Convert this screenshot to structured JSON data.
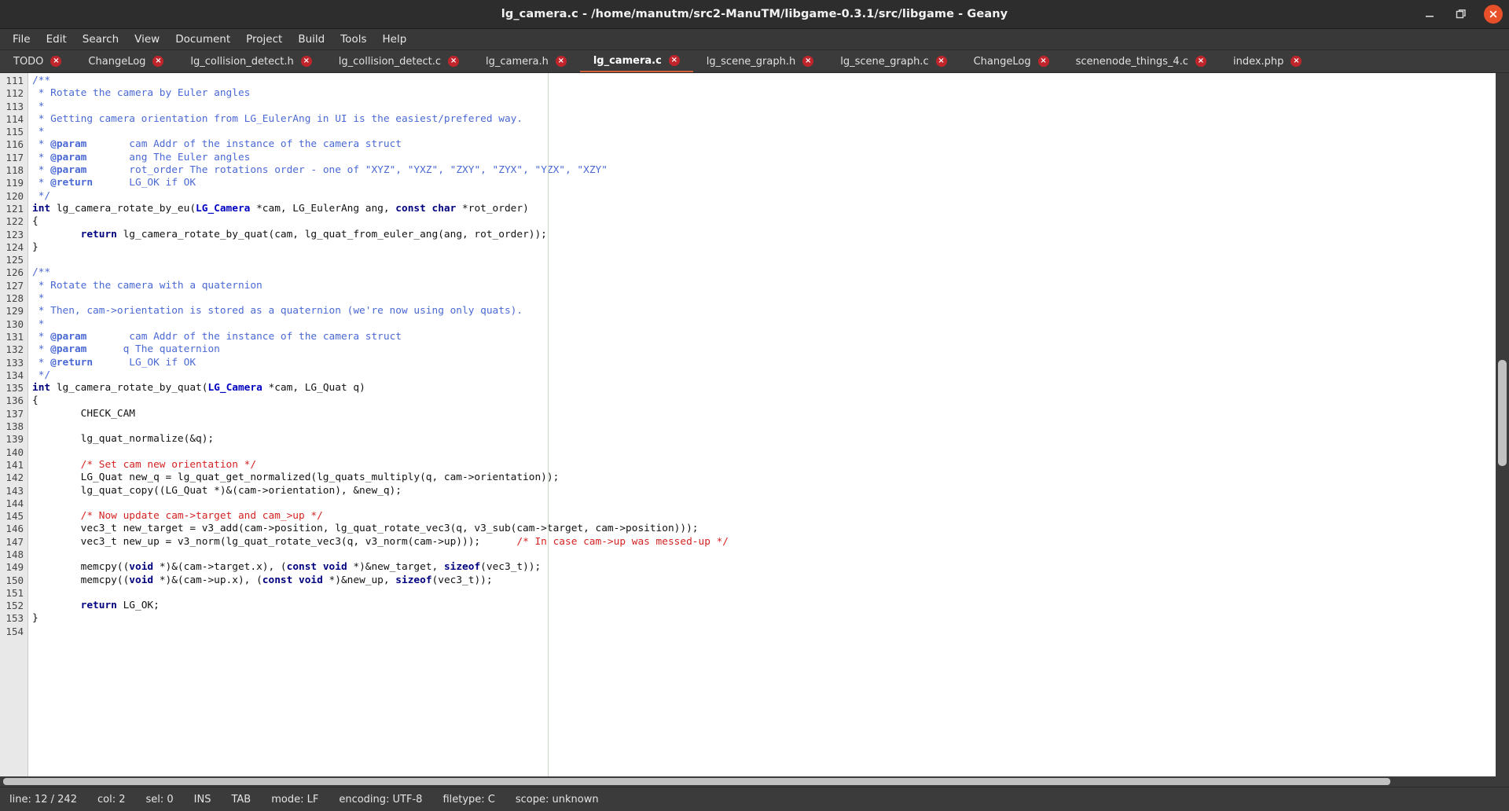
{
  "window": {
    "title": "lg_camera.c - /home/manutm/src2-ManuTM/libgame-0.3.1/src/libgame - Geany",
    "controls": {
      "minimize": "minimize-icon",
      "maximize": "maximize-icon",
      "close": "close-icon"
    }
  },
  "menubar": {
    "items": [
      {
        "label": "File"
      },
      {
        "label": "Edit"
      },
      {
        "label": "Search"
      },
      {
        "label": "View"
      },
      {
        "label": "Document"
      },
      {
        "label": "Project"
      },
      {
        "label": "Build"
      },
      {
        "label": "Tools"
      },
      {
        "label": "Help"
      }
    ]
  },
  "tabs": {
    "close_glyph": "×",
    "items": [
      {
        "label": "TODO",
        "active": false
      },
      {
        "label": "ChangeLog",
        "active": false
      },
      {
        "label": "lg_collision_detect.h",
        "active": false
      },
      {
        "label": "lg_collision_detect.c",
        "active": false
      },
      {
        "label": "lg_camera.h",
        "active": false
      },
      {
        "label": "lg_camera.c",
        "active": true
      },
      {
        "label": "lg_scene_graph.h",
        "active": false
      },
      {
        "label": "lg_scene_graph.c",
        "active": false
      },
      {
        "label": "ChangeLog",
        "active": false
      },
      {
        "label": "scenenode_things_4.c",
        "active": false
      },
      {
        "label": "index.php",
        "active": false
      }
    ]
  },
  "editor": {
    "first_line": 111,
    "lines": [
      {
        "n": 111,
        "tokens": [
          {
            "t": "/**",
            "c": "t-com"
          }
        ]
      },
      {
        "n": 112,
        "tokens": [
          {
            "t": " * Rotate the camera by Euler angles",
            "c": "t-com"
          }
        ]
      },
      {
        "n": 113,
        "tokens": [
          {
            "t": " *",
            "c": "t-com"
          }
        ]
      },
      {
        "n": 114,
        "tokens": [
          {
            "t": " * Getting camera orientation from LG_EulerAng in UI is the easiest/prefered way.",
            "c": "t-com"
          }
        ]
      },
      {
        "n": 115,
        "tokens": [
          {
            "t": " *",
            "c": "t-com"
          }
        ]
      },
      {
        "n": 116,
        "tokens": [
          {
            "t": " * ",
            "c": "t-com"
          },
          {
            "t": "@param",
            "c": "t-doc"
          },
          {
            "t": "       cam Addr of the instance of the camera struct",
            "c": "t-com"
          }
        ]
      },
      {
        "n": 117,
        "tokens": [
          {
            "t": " * ",
            "c": "t-com"
          },
          {
            "t": "@param",
            "c": "t-doc"
          },
          {
            "t": "       ang The Euler angles",
            "c": "t-com"
          }
        ]
      },
      {
        "n": 118,
        "tokens": [
          {
            "t": " * ",
            "c": "t-com"
          },
          {
            "t": "@param",
            "c": "t-doc"
          },
          {
            "t": "       rot_order The rotations order - one of \"XYZ\", \"YXZ\", \"ZXY\", \"ZYX\", \"YZX\", \"XZY\"",
            "c": "t-com"
          }
        ]
      },
      {
        "n": 119,
        "tokens": [
          {
            "t": " * ",
            "c": "t-com"
          },
          {
            "t": "@return",
            "c": "t-doc"
          },
          {
            "t": "      LG_OK if OK",
            "c": "t-com"
          }
        ]
      },
      {
        "n": 120,
        "tokens": [
          {
            "t": " */",
            "c": "t-com"
          }
        ]
      },
      {
        "n": 121,
        "tokens": [
          {
            "t": "int",
            "c": "t-kw"
          },
          {
            "t": " lg_camera_rotate_by_eu(",
            "c": "t-pl"
          },
          {
            "t": "LG_Camera",
            "c": "t-type"
          },
          {
            "t": " *cam, LG_EulerAng ang, ",
            "c": "t-pl"
          },
          {
            "t": "const char",
            "c": "t-kw"
          },
          {
            "t": " *rot_order)",
            "c": "t-pl"
          }
        ]
      },
      {
        "n": 122,
        "tokens": [
          {
            "t": "{",
            "c": "t-pl"
          }
        ]
      },
      {
        "n": 123,
        "tokens": [
          {
            "t": "        ",
            "c": "t-pl"
          },
          {
            "t": "return",
            "c": "t-kw"
          },
          {
            "t": " lg_camera_rotate_by_quat(cam, lg_quat_from_euler_ang(ang, rot_order));",
            "c": "t-pl"
          }
        ]
      },
      {
        "n": 124,
        "tokens": [
          {
            "t": "}",
            "c": "t-pl"
          }
        ]
      },
      {
        "n": 125,
        "tokens": [
          {
            "t": "",
            "c": "t-pl"
          }
        ]
      },
      {
        "n": 126,
        "tokens": [
          {
            "t": "/**",
            "c": "t-com"
          }
        ]
      },
      {
        "n": 127,
        "tokens": [
          {
            "t": " * Rotate the camera with a quaternion",
            "c": "t-com"
          }
        ]
      },
      {
        "n": 128,
        "tokens": [
          {
            "t": " *",
            "c": "t-com"
          }
        ]
      },
      {
        "n": 129,
        "tokens": [
          {
            "t": " * Then, cam->orientation is stored as a quaternion (we're now using only quats).",
            "c": "t-com"
          }
        ]
      },
      {
        "n": 130,
        "tokens": [
          {
            "t": " *",
            "c": "t-com"
          }
        ]
      },
      {
        "n": 131,
        "tokens": [
          {
            "t": " * ",
            "c": "t-com"
          },
          {
            "t": "@param",
            "c": "t-doc"
          },
          {
            "t": "       cam Addr of the instance of the camera struct",
            "c": "t-com"
          }
        ]
      },
      {
        "n": 132,
        "tokens": [
          {
            "t": " * ",
            "c": "t-com"
          },
          {
            "t": "@param",
            "c": "t-doc"
          },
          {
            "t": "      q The quaternion",
            "c": "t-com"
          }
        ]
      },
      {
        "n": 133,
        "tokens": [
          {
            "t": " * ",
            "c": "t-com"
          },
          {
            "t": "@return",
            "c": "t-doc"
          },
          {
            "t": "      LG_OK if OK",
            "c": "t-com"
          }
        ]
      },
      {
        "n": 134,
        "tokens": [
          {
            "t": " */",
            "c": "t-com"
          }
        ]
      },
      {
        "n": 135,
        "tokens": [
          {
            "t": "int",
            "c": "t-kw"
          },
          {
            "t": " lg_camera_rotate_by_quat(",
            "c": "t-pl"
          },
          {
            "t": "LG_Camera",
            "c": "t-type"
          },
          {
            "t": " *cam, LG_Quat q)",
            "c": "t-pl"
          }
        ]
      },
      {
        "n": 136,
        "tokens": [
          {
            "t": "{",
            "c": "t-pl"
          }
        ]
      },
      {
        "n": 137,
        "tokens": [
          {
            "t": "        CHECK_CAM",
            "c": "t-pl"
          }
        ]
      },
      {
        "n": 138,
        "tokens": [
          {
            "t": "",
            "c": "t-pl"
          }
        ]
      },
      {
        "n": 139,
        "tokens": [
          {
            "t": "        lg_quat_normalize(&q);",
            "c": "t-pl"
          }
        ]
      },
      {
        "n": 140,
        "tokens": [
          {
            "t": "",
            "c": "t-pl"
          }
        ]
      },
      {
        "n": 141,
        "tokens": [
          {
            "t": "        ",
            "c": "t-pl"
          },
          {
            "t": "/* Set cam new orientation */",
            "c": "t-comr"
          }
        ]
      },
      {
        "n": 142,
        "tokens": [
          {
            "t": "        LG_Quat new_q = lg_quat_get_normalized(lg_quats_multiply(q, cam->orientation));",
            "c": "t-pl"
          }
        ]
      },
      {
        "n": 143,
        "tokens": [
          {
            "t": "        lg_quat_copy((LG_Quat *)&(cam->orientation), &new_q);",
            "c": "t-pl"
          }
        ]
      },
      {
        "n": 144,
        "tokens": [
          {
            "t": "",
            "c": "t-pl"
          }
        ]
      },
      {
        "n": 145,
        "tokens": [
          {
            "t": "        ",
            "c": "t-pl"
          },
          {
            "t": "/* Now update cam->target and cam_>up */",
            "c": "t-comr"
          }
        ]
      },
      {
        "n": 146,
        "tokens": [
          {
            "t": "        vec3_t new_target = v3_add(cam->position, lg_quat_rotate_vec3(q, v3_sub(cam->target, cam->position)));",
            "c": "t-pl"
          }
        ]
      },
      {
        "n": 147,
        "tokens": [
          {
            "t": "        vec3_t new_up = v3_norm(lg_quat_rotate_vec3(q, v3_norm(cam->up)));      ",
            "c": "t-pl"
          },
          {
            "t": "/* In case cam->up was messed-up */",
            "c": "t-comr"
          }
        ]
      },
      {
        "n": 148,
        "tokens": [
          {
            "t": "",
            "c": "t-pl"
          }
        ]
      },
      {
        "n": 149,
        "tokens": [
          {
            "t": "        memcpy((",
            "c": "t-pl"
          },
          {
            "t": "void",
            "c": "t-kw"
          },
          {
            "t": " *)&(cam->target.x), (",
            "c": "t-pl"
          },
          {
            "t": "const void",
            "c": "t-kw"
          },
          {
            "t": " *)&new_target, ",
            "c": "t-pl"
          },
          {
            "t": "sizeof",
            "c": "t-kw"
          },
          {
            "t": "(vec3_t));",
            "c": "t-pl"
          }
        ]
      },
      {
        "n": 150,
        "tokens": [
          {
            "t": "        memcpy((",
            "c": "t-pl"
          },
          {
            "t": "void",
            "c": "t-kw"
          },
          {
            "t": " *)&(cam->up.x), (",
            "c": "t-pl"
          },
          {
            "t": "const void",
            "c": "t-kw"
          },
          {
            "t": " *)&new_up, ",
            "c": "t-pl"
          },
          {
            "t": "sizeof",
            "c": "t-kw"
          },
          {
            "t": "(vec3_t));",
            "c": "t-pl"
          }
        ]
      },
      {
        "n": 151,
        "tokens": [
          {
            "t": "",
            "c": "t-pl"
          }
        ]
      },
      {
        "n": 152,
        "tokens": [
          {
            "t": "        ",
            "c": "t-pl"
          },
          {
            "t": "return",
            "c": "t-kw"
          },
          {
            "t": " LG_OK;",
            "c": "t-pl"
          }
        ]
      },
      {
        "n": 153,
        "tokens": [
          {
            "t": "}",
            "c": "t-pl"
          }
        ]
      },
      {
        "n": 154,
        "tokens": [
          {
            "t": "",
            "c": "t-pl"
          }
        ]
      }
    ]
  },
  "statusbar": {
    "items": [
      {
        "label": "line: 12 / 242"
      },
      {
        "label": "col: 2"
      },
      {
        "label": "sel: 0"
      },
      {
        "label": "INS"
      },
      {
        "label": "TAB"
      },
      {
        "label": "mode: LF"
      },
      {
        "label": "encoding: UTF-8"
      },
      {
        "label": "filetype: C"
      },
      {
        "label": "scope: unknown"
      }
    ]
  },
  "colors": {
    "titlebar_bg": "#2d2d2d",
    "menubar_bg": "#383838",
    "tabbar_bg": "#3b3b3b",
    "editor_bg": "#ffffff",
    "gutter_bg": "#e8e8e8",
    "close_button": "#e8502a",
    "tab_close_badge": "#c0252b",
    "active_tab_underline": "#d35f3a",
    "comment": "#4a69d4",
    "comment_red": "#d42323",
    "keyword": "#00007f",
    "type": "#0000c0"
  }
}
